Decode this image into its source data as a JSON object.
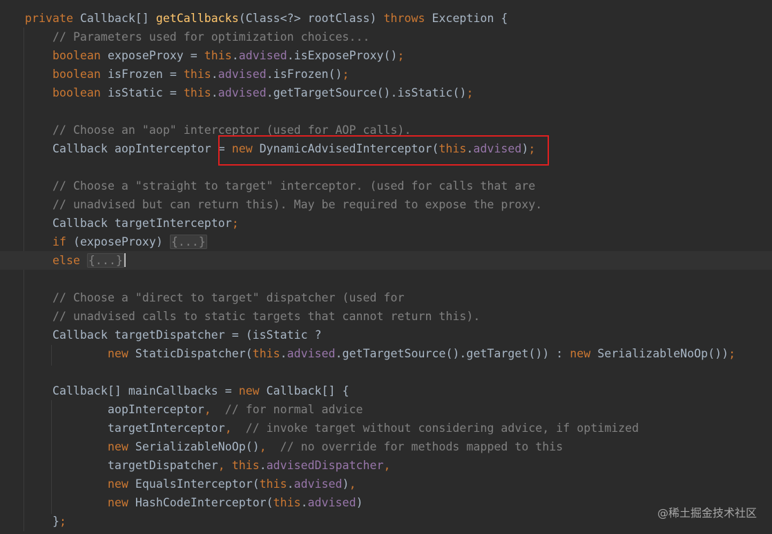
{
  "editor": {
    "lines": [
      [
        [
          "kw",
          "private "
        ],
        [
          "plain",
          "Callback[] "
        ],
        [
          "fn",
          "getCallbacks"
        ],
        [
          "plain",
          "(Class<?> rootClass) "
        ],
        [
          "kw",
          "throws "
        ],
        [
          "plain",
          "Exception {"
        ]
      ],
      [
        [
          "plain",
          "    "
        ],
        [
          "cm",
          "// Parameters used for optimization choices..."
        ]
      ],
      [
        [
          "plain",
          "    "
        ],
        [
          "kw",
          "boolean "
        ],
        [
          "plain",
          "exposeProxy = "
        ],
        [
          "kw",
          "this"
        ],
        [
          "plain",
          "."
        ],
        [
          "fld",
          "advised"
        ],
        [
          "plain",
          ".isExposeProxy()"
        ],
        [
          "kw",
          ";"
        ]
      ],
      [
        [
          "plain",
          "    "
        ],
        [
          "kw",
          "boolean "
        ],
        [
          "plain",
          "isFrozen = "
        ],
        [
          "kw",
          "this"
        ],
        [
          "plain",
          "."
        ],
        [
          "fld",
          "advised"
        ],
        [
          "plain",
          ".isFrozen()"
        ],
        [
          "kw",
          ";"
        ]
      ],
      [
        [
          "plain",
          "    "
        ],
        [
          "kw",
          "boolean "
        ],
        [
          "plain",
          "isStatic = "
        ],
        [
          "kw",
          "this"
        ],
        [
          "plain",
          "."
        ],
        [
          "fld",
          "advised"
        ],
        [
          "plain",
          ".getTargetSource().isStatic()"
        ],
        [
          "kw",
          ";"
        ]
      ],
      [],
      [
        [
          "plain",
          "    "
        ],
        [
          "cm",
          "// Choose an \"aop\" interceptor (used for AOP calls)."
        ]
      ],
      [
        [
          "plain",
          "    Callback aopInterceptor = "
        ],
        [
          "kw",
          "new "
        ],
        [
          "plain",
          "DynamicAdvisedInterceptor("
        ],
        [
          "kw",
          "this"
        ],
        [
          "plain",
          "."
        ],
        [
          "fld",
          "advised"
        ],
        [
          "plain",
          ")"
        ],
        [
          "kw",
          ";"
        ]
      ],
      [],
      [
        [
          "plain",
          "    "
        ],
        [
          "cm",
          "// Choose a \"straight to target\" interceptor. (used for calls that are"
        ]
      ],
      [
        [
          "plain",
          "    "
        ],
        [
          "cm",
          "// unadvised but can return this). May be required to expose the proxy."
        ]
      ],
      [
        [
          "plain",
          "    Callback targetInterceptor"
        ],
        [
          "kw",
          ";"
        ]
      ],
      [
        [
          "plain",
          "    "
        ],
        [
          "kw",
          "if "
        ],
        [
          "plain",
          "(exposeProxy) "
        ],
        [
          "fold",
          "{...}"
        ]
      ],
      [
        [
          "plain",
          "    "
        ],
        [
          "kw",
          "else "
        ],
        [
          "fold",
          "{...}"
        ],
        [
          "caret",
          ""
        ]
      ],
      [],
      [
        [
          "plain",
          "    "
        ],
        [
          "cm",
          "// Choose a \"direct to target\" dispatcher (used for"
        ]
      ],
      [
        [
          "plain",
          "    "
        ],
        [
          "cm",
          "// unadvised calls to static targets that cannot return this)."
        ]
      ],
      [
        [
          "plain",
          "    Callback targetDispatcher = (isStatic ?"
        ]
      ],
      [
        [
          "plain",
          "            "
        ],
        [
          "kw",
          "new "
        ],
        [
          "plain",
          "StaticDispatcher("
        ],
        [
          "kw",
          "this"
        ],
        [
          "plain",
          "."
        ],
        [
          "fld",
          "advised"
        ],
        [
          "plain",
          ".getTargetSource().getTarget()) : "
        ],
        [
          "kw",
          "new "
        ],
        [
          "plain",
          "SerializableNoOp())"
        ],
        [
          "kw",
          ";"
        ]
      ],
      [],
      [
        [
          "plain",
          "    Callback[] mainCallbacks = "
        ],
        [
          "kw",
          "new "
        ],
        [
          "plain",
          "Callback[] {"
        ]
      ],
      [
        [
          "plain",
          "            aopInterceptor"
        ],
        [
          "kw",
          ",  "
        ],
        [
          "cm",
          "// for normal advice"
        ]
      ],
      [
        [
          "plain",
          "            targetInterceptor"
        ],
        [
          "kw",
          ",  "
        ],
        [
          "cm",
          "// invoke target without considering advice, if optimized"
        ]
      ],
      [
        [
          "plain",
          "            "
        ],
        [
          "kw",
          "new "
        ],
        [
          "plain",
          "SerializableNoOp()"
        ],
        [
          "kw",
          ",  "
        ],
        [
          "cm",
          "// no override for methods mapped to this"
        ]
      ],
      [
        [
          "plain",
          "            targetDispatcher"
        ],
        [
          "kw",
          ", "
        ],
        [
          "kw",
          "this"
        ],
        [
          "plain",
          "."
        ],
        [
          "fld",
          "advisedDispatcher"
        ],
        [
          "kw",
          ","
        ]
      ],
      [
        [
          "plain",
          "            "
        ],
        [
          "kw",
          "new "
        ],
        [
          "plain",
          "EqualsInterceptor("
        ],
        [
          "kw",
          "this"
        ],
        [
          "plain",
          "."
        ],
        [
          "fld",
          "advised"
        ],
        [
          "plain",
          ")"
        ],
        [
          "kw",
          ","
        ]
      ],
      [
        [
          "plain",
          "            "
        ],
        [
          "kw",
          "new "
        ],
        [
          "plain",
          "HashCodeInterceptor("
        ],
        [
          "kw",
          "this"
        ],
        [
          "plain",
          "."
        ],
        [
          "fld",
          "advised"
        ],
        [
          "plain",
          ")"
        ]
      ],
      [
        [
          "plain",
          "    }"
        ],
        [
          "kw",
          ";"
        ]
      ]
    ],
    "current_line_index": 13
  },
  "watermark": "@稀土掘金技术社区",
  "colors": {
    "background": "#2b2b2b",
    "keyword": "#cc7832",
    "method": "#ffc66d",
    "field": "#9876aa",
    "comment": "#808080",
    "text": "#a9b7c6",
    "highlight_box": "#e02020"
  }
}
